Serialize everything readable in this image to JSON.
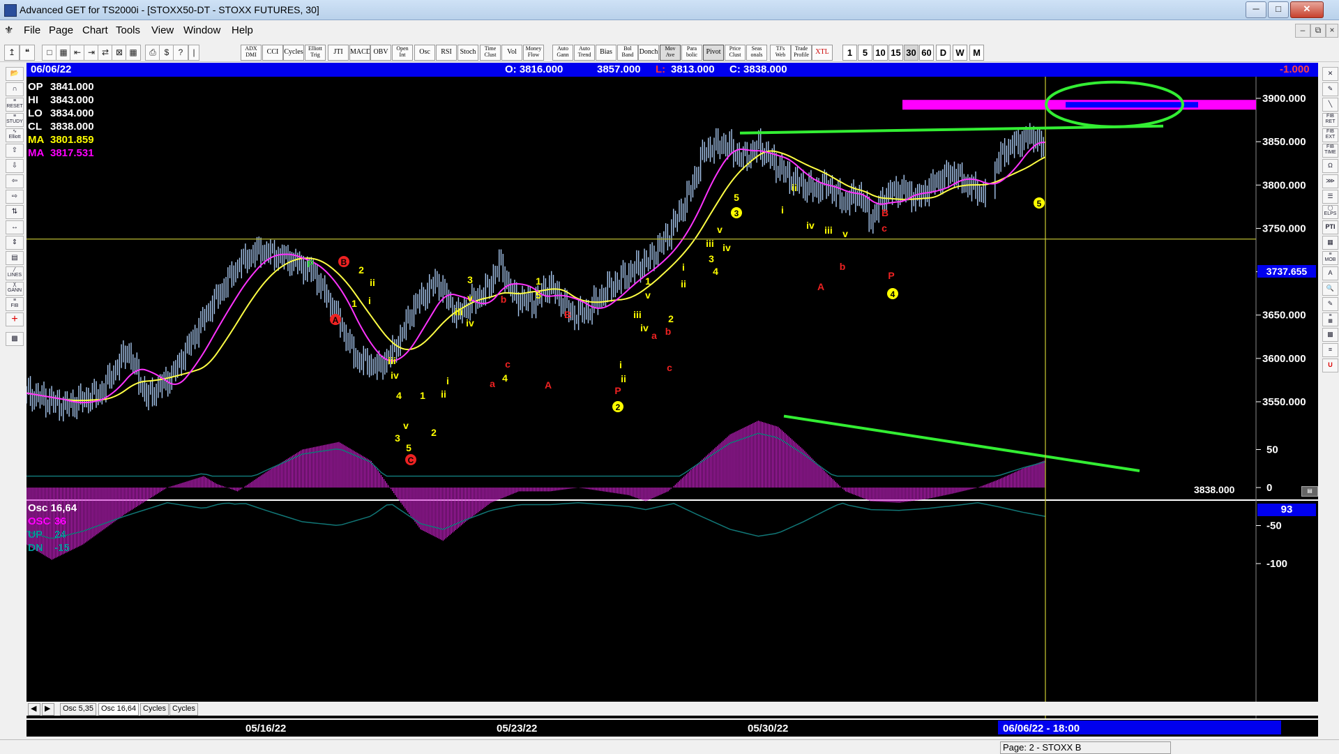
{
  "window": {
    "title": "Advanced GET for TS2000i - [STOXX50-DT - STOXX FUTURES, 30]"
  },
  "menu": [
    "File",
    "Page",
    "Chart",
    "Tools",
    "View",
    "Window",
    "Help"
  ],
  "toolbar": {
    "indicators": [
      "ADX DMI",
      "CCI",
      "Cycles",
      "Elliott Trig",
      "JTI",
      "MACD",
      "OBV",
      "Open Int",
      "Osc",
      "RSI",
      "Stoch",
      "Time Clust",
      "Vol",
      "Money Flow",
      "Auto Gann",
      "Auto Trend",
      "Bias",
      "Bol Band",
      "Donch",
      "Mov Ave",
      "Para bolic",
      "Pivot",
      "Price Clust",
      "Seas onals",
      "TJ's Web",
      "Trade Profile",
      "XTL"
    ],
    "timeframes": [
      "1",
      "5",
      "10",
      "15",
      "30",
      "60",
      "D",
      "W",
      "M"
    ],
    "selected_timeframe": "30"
  },
  "header": {
    "date": "06/06/22",
    "open": "O: 3816.000",
    "high": "3857.000",
    "low_label": "L:",
    "low": "3813.000",
    "close": "C: 3838.000",
    "change": "-1.000"
  },
  "readouts": [
    {
      "label": "OP",
      "value": "3841.000",
      "color": "#ffffff"
    },
    {
      "label": "HI",
      "value": "3843.000",
      "color": "#ffffff"
    },
    {
      "label": "LO",
      "value": "3834.000",
      "color": "#ffffff"
    },
    {
      "label": "CL",
      "value": "3838.000",
      "color": "#ffffff"
    },
    {
      "label": "MA",
      "value": "3801.859",
      "color": "#ffff00"
    },
    {
      "label": "MA",
      "value": "3817.531",
      "color": "#ff00ff"
    }
  ],
  "osc_readouts": [
    {
      "label": "Osc 16,64",
      "value": "",
      "color": "#ffffff"
    },
    {
      "label": "OSC",
      "value": "36",
      "color": "#ff00ff"
    },
    {
      "label": "UP",
      "value": "24",
      "color": "#009999"
    },
    {
      "label": "DN",
      "value": "-15",
      "color": "#009999"
    }
  ],
  "price_axis": [
    "3900.000",
    "3850.000",
    "3800.000",
    "3750.000",
    "3700.000",
    "3650.000",
    "3600.000",
    "3550.000"
  ],
  "price_marker": "3737.655",
  "last_price": "3838.000",
  "osc_axis": [
    "50",
    "0",
    "-50",
    "-100"
  ],
  "osc_marker": "93",
  "date_axis": [
    "05/16/22",
    "05/23/22",
    "05/30/22"
  ],
  "cursor_date": "06/06/22 - 18:00",
  "bottom_tabs": [
    "Osc 5,35",
    "Osc 16,64",
    "Cycles",
    "Cycles"
  ],
  "status": "Page: 2 - STOXX B",
  "wave_labels": [
    {
      "t": "P",
      "c": "#22cc22"
    },
    {
      "t": "B",
      "c": "#ee2222"
    },
    {
      "t": "A",
      "c": "#ee2222"
    },
    {
      "t": "2",
      "c": "#ffff00"
    },
    {
      "t": "1",
      "c": "#ffff00"
    },
    {
      "t": "ii",
      "c": "#ffff00"
    },
    {
      "t": "i",
      "c": "#ffff00"
    },
    {
      "t": "iii",
      "c": "#ffff00"
    },
    {
      "t": "iv",
      "c": "#ffff00"
    },
    {
      "t": "4",
      "c": "#ffff00"
    },
    {
      "t": "1",
      "c": "#ffff00"
    },
    {
      "t": "v",
      "c": "#ffff00"
    },
    {
      "t": "3",
      "c": "#ffff00"
    },
    {
      "t": "5",
      "c": "#ffff00"
    },
    {
      "t": "2",
      "c": "#ffff00"
    },
    {
      "t": "C",
      "c": "#ee2222"
    },
    {
      "t": "i",
      "c": "#ffff00"
    },
    {
      "t": "ii",
      "c": "#ffff00"
    },
    {
      "t": "3",
      "c": "#ffff00"
    },
    {
      "t": "v",
      "c": "#ffff00"
    },
    {
      "t": "iii",
      "c": "#ffff00"
    },
    {
      "t": "iv",
      "c": "#ffff00"
    },
    {
      "t": "b",
      "c": "#ee2222"
    },
    {
      "t": "a",
      "c": "#ee2222"
    },
    {
      "t": "c",
      "c": "#ee2222"
    },
    {
      "t": "4",
      "c": "#ffff00"
    },
    {
      "t": "1",
      "c": "#ffff00"
    },
    {
      "t": "5",
      "c": "#ffff00"
    },
    {
      "t": "B",
      "c": "#ee2222"
    },
    {
      "t": "A",
      "c": "#ee2222"
    },
    {
      "t": "P",
      "c": "#ee2222"
    },
    {
      "t": "2",
      "c": "#ffff00"
    },
    {
      "t": "i",
      "c": "#ffff00"
    },
    {
      "t": "ii",
      "c": "#ffff00"
    },
    {
      "t": "1",
      "c": "#ffff00"
    },
    {
      "t": "v",
      "c": "#ffff00"
    },
    {
      "t": "iii",
      "c": "#ffff00"
    },
    {
      "t": "iv",
      "c": "#ffff00"
    },
    {
      "t": "a",
      "c": "#ee2222"
    },
    {
      "t": "b",
      "c": "#ee2222"
    },
    {
      "t": "c",
      "c": "#ee2222"
    },
    {
      "t": "2",
      "c": "#ffff00"
    },
    {
      "t": "i",
      "c": "#ffff00"
    },
    {
      "t": "ii",
      "c": "#ffff00"
    },
    {
      "t": "iii",
      "c": "#ffff00"
    },
    {
      "t": "iv",
      "c": "#ffff00"
    },
    {
      "t": "v",
      "c": "#ffff00"
    },
    {
      "t": "3",
      "c": "#ffff00"
    },
    {
      "t": "4",
      "c": "#ffff00"
    },
    {
      "t": "3",
      "c": "#ffff00"
    },
    {
      "t": "5",
      "c": "#ffff00"
    },
    {
      "t": "ii",
      "c": "#ffff00"
    },
    {
      "t": "i",
      "c": "#ffff00"
    },
    {
      "t": "iv",
      "c": "#ffff00"
    },
    {
      "t": "iii",
      "c": "#ffff00"
    },
    {
      "t": "v",
      "c": "#ffff00"
    },
    {
      "t": "A",
      "c": "#ee2222"
    },
    {
      "t": "b",
      "c": "#ee2222"
    },
    {
      "t": "B",
      "c": "#ee2222"
    },
    {
      "t": "c",
      "c": "#ee2222"
    },
    {
      "t": "P",
      "c": "#ee2222"
    },
    {
      "t": "4",
      "c": "#ffff00"
    },
    {
      "t": "5",
      "c": "#ffff00"
    }
  ],
  "chart_data": {
    "type": "line",
    "series": [
      {
        "x": [
          "05/16/22",
          "05/23/22",
          "05/30/22",
          "06/06/22 - 18:00"
        ],
        "y": [
          3560,
          3665,
          3845,
          3838
        ]
      }
    ],
    "ylim": [
      3530,
      3915
    ],
    "osc_ylim": [
      -110,
      95
    ]
  }
}
